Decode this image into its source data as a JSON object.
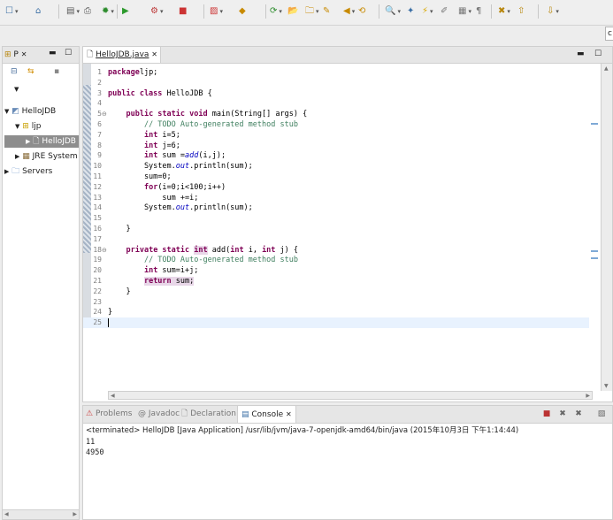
{
  "toolbar": {
    "buttons": [
      "new",
      "save",
      "save-all",
      "print",
      "debug",
      "run",
      "run-ext",
      "stop",
      "open-type",
      "new-class",
      "refresh",
      "open-folder",
      "open-task",
      "edit",
      "next",
      "prev",
      "search",
      "toggle-mark",
      "highlight",
      "show-whitespace",
      "show-block",
      "next-annotation",
      "prev-annotation",
      "back",
      "forward"
    ],
    "icons": [
      "☐",
      "⌂",
      "▤",
      "⎙",
      "✹",
      "▶",
      "⚙",
      "■",
      "▨",
      "◆",
      "⟳",
      "📂",
      "🗀",
      "✎",
      "◀",
      "⟲",
      "🔍",
      "✦",
      "⚡",
      "✐",
      "▦",
      "¶",
      "✖",
      "⇧",
      "⇩"
    ]
  },
  "package_explorer": {
    "tab_label": "P",
    "tree": [
      {
        "label": "HelloJDB",
        "icon": "project-icon"
      },
      {
        "label": "ljp",
        "icon": "package-icon"
      },
      {
        "label": "HelloJDB",
        "icon": "java-file-icon"
      },
      {
        "label": "JRE System",
        "icon": "library-icon"
      },
      {
        "label": "Servers",
        "icon": "folder-icon"
      }
    ]
  },
  "editor": {
    "tab_label": "HelloJDB.java",
    "lines": [
      {
        "n": "1",
        "segs": [
          [
            "kw",
            "package"
          ],
          [
            "",
            "ljp;"
          ]
        ]
      },
      {
        "n": "2",
        "segs": []
      },
      {
        "n": "3",
        "segs": [
          [
            "kw",
            "public class"
          ],
          [
            "",
            " HelloJDB {"
          ]
        ]
      },
      {
        "n": "4",
        "segs": []
      },
      {
        "n": "5⊖",
        "segs": [
          [
            "",
            "    "
          ],
          [
            "kw",
            "public static void"
          ],
          [
            "",
            " main(String[] args) {"
          ]
        ]
      },
      {
        "n": "6",
        "segs": [
          [
            "",
            "        "
          ],
          [
            "cm",
            "// TODO Auto-generated method stub"
          ]
        ]
      },
      {
        "n": "7",
        "segs": [
          [
            "",
            "        "
          ],
          [
            "kw",
            "int"
          ],
          [
            "",
            " i=5;"
          ]
        ]
      },
      {
        "n": "8",
        "segs": [
          [
            "",
            "        "
          ],
          [
            "kw",
            "int"
          ],
          [
            "",
            " j=6;"
          ]
        ]
      },
      {
        "n": "9",
        "segs": [
          [
            "",
            "        "
          ],
          [
            "kw",
            "int"
          ],
          [
            "",
            " sum ="
          ],
          [
            "fd",
            "add"
          ],
          [
            "",
            "(i,j);"
          ]
        ]
      },
      {
        "n": "10",
        "segs": [
          [
            "",
            "        System."
          ],
          [
            "fd",
            "out"
          ],
          [
            "",
            ".println(sum);"
          ]
        ]
      },
      {
        "n": "11",
        "segs": [
          [
            "",
            "        sum=0;"
          ]
        ]
      },
      {
        "n": "12",
        "segs": [
          [
            "",
            "        "
          ],
          [
            "kw",
            "for"
          ],
          [
            "",
            "(i=0;i<100;i++)"
          ]
        ]
      },
      {
        "n": "13",
        "segs": [
          [
            "",
            "            sum +=i;"
          ]
        ]
      },
      {
        "n": "14",
        "segs": [
          [
            "",
            "        System."
          ],
          [
            "fd",
            "out"
          ],
          [
            "",
            ".println(sum);"
          ]
        ]
      },
      {
        "n": "15",
        "segs": []
      },
      {
        "n": "16",
        "segs": [
          [
            "",
            "    }"
          ]
        ]
      },
      {
        "n": "17",
        "segs": []
      },
      {
        "n": "18⊖",
        "segs": [
          [
            "",
            "    "
          ],
          [
            "kw",
            "private static"
          ],
          [
            "",
            " "
          ],
          [
            "kwhl",
            "int"
          ],
          [
            "",
            " add("
          ],
          [
            "kw",
            "int"
          ],
          [
            "",
            " i, "
          ],
          [
            "kw",
            "int"
          ],
          [
            "",
            " j) {"
          ]
        ]
      },
      {
        "n": "19",
        "segs": [
          [
            "",
            "        "
          ],
          [
            "cm",
            "// TODO Auto-generated method stub"
          ]
        ]
      },
      {
        "n": "20",
        "segs": [
          [
            "",
            "        "
          ],
          [
            "kw",
            "int"
          ],
          [
            "",
            " sum=i+j;"
          ]
        ]
      },
      {
        "n": "21",
        "segs": [
          [
            "",
            "        "
          ],
          [
            "kwhl",
            "return"
          ],
          [
            "hl",
            " sum;"
          ]
        ]
      },
      {
        "n": "22",
        "segs": [
          [
            "",
            "    }"
          ]
        ]
      },
      {
        "n": "23",
        "segs": []
      },
      {
        "n": "24",
        "segs": [
          [
            "",
            "}"
          ]
        ]
      },
      {
        "n": "25",
        "segs": []
      }
    ]
  },
  "console": {
    "tabs": [
      {
        "label": "Problems",
        "icon": "problems-icon"
      },
      {
        "label": "Javadoc",
        "icon": "javadoc-icon"
      },
      {
        "label": "Declaration",
        "icon": "declaration-icon"
      },
      {
        "label": "Console",
        "icon": "console-icon"
      }
    ],
    "status": "<terminated> HelloJDB [Java Application] /usr/lib/jvm/java-7-openjdk-amd64/bin/java (2015年10月3日 下午1:14:44)",
    "output": [
      "11",
      "4950"
    ]
  },
  "quick_access": "c"
}
